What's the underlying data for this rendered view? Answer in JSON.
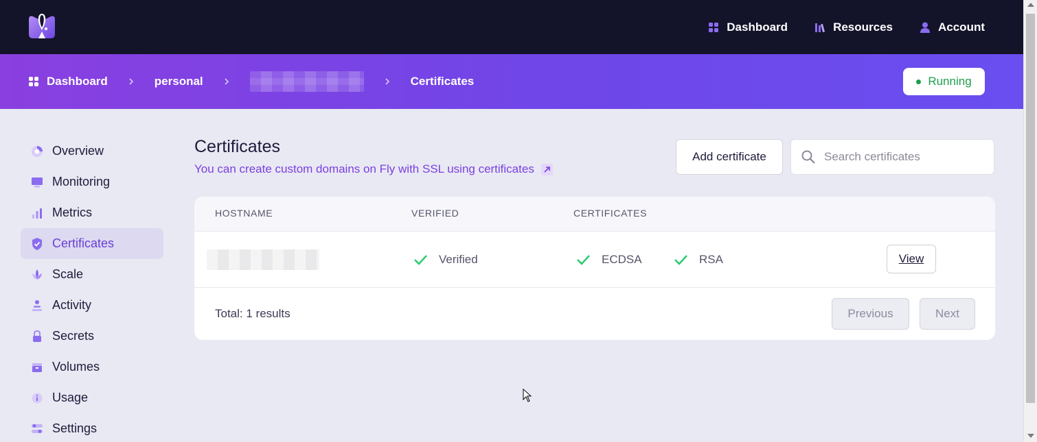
{
  "topnav": {
    "items": [
      {
        "label": "Dashboard",
        "icon": "grid-icon"
      },
      {
        "label": "Resources",
        "icon": "library-icon"
      },
      {
        "label": "Account",
        "icon": "user-icon"
      }
    ]
  },
  "breadcrumb": {
    "items": [
      "Dashboard",
      "personal",
      "",
      "Certificates"
    ]
  },
  "status": {
    "label": "Running",
    "color": "#1f9d4c"
  },
  "sidebar": {
    "items": [
      {
        "label": "Overview",
        "icon": "overview-icon"
      },
      {
        "label": "Monitoring",
        "icon": "monitor-icon"
      },
      {
        "label": "Metrics",
        "icon": "bar-chart-icon"
      },
      {
        "label": "Certificates",
        "icon": "shield-check-icon",
        "active": true
      },
      {
        "label": "Scale",
        "icon": "scale-icon"
      },
      {
        "label": "Activity",
        "icon": "activity-icon"
      },
      {
        "label": "Secrets",
        "icon": "lock-icon"
      },
      {
        "label": "Volumes",
        "icon": "box-icon"
      },
      {
        "label": "Usage",
        "icon": "info-icon"
      },
      {
        "label": "Settings",
        "icon": "toggles-icon"
      }
    ]
  },
  "main": {
    "title": "Certificates",
    "subtitle": "You can create custom domains on Fly with SSL using certificates",
    "add_label": "Add certificate",
    "search_placeholder": "Search certificates"
  },
  "table": {
    "columns": [
      "HOSTNAME",
      "VERIFIED",
      "CERTIFICATES"
    ],
    "rows": [
      {
        "hostname": "",
        "verified": "Verified",
        "certs": [
          "ECDSA",
          "RSA"
        ],
        "action": "View"
      }
    ],
    "total": "Total: 1 results",
    "prev_label": "Previous",
    "next_label": "Next"
  },
  "colors": {
    "accent": "#7b3fe0",
    "topbar": "#13132a",
    "check": "#2ecc71"
  }
}
